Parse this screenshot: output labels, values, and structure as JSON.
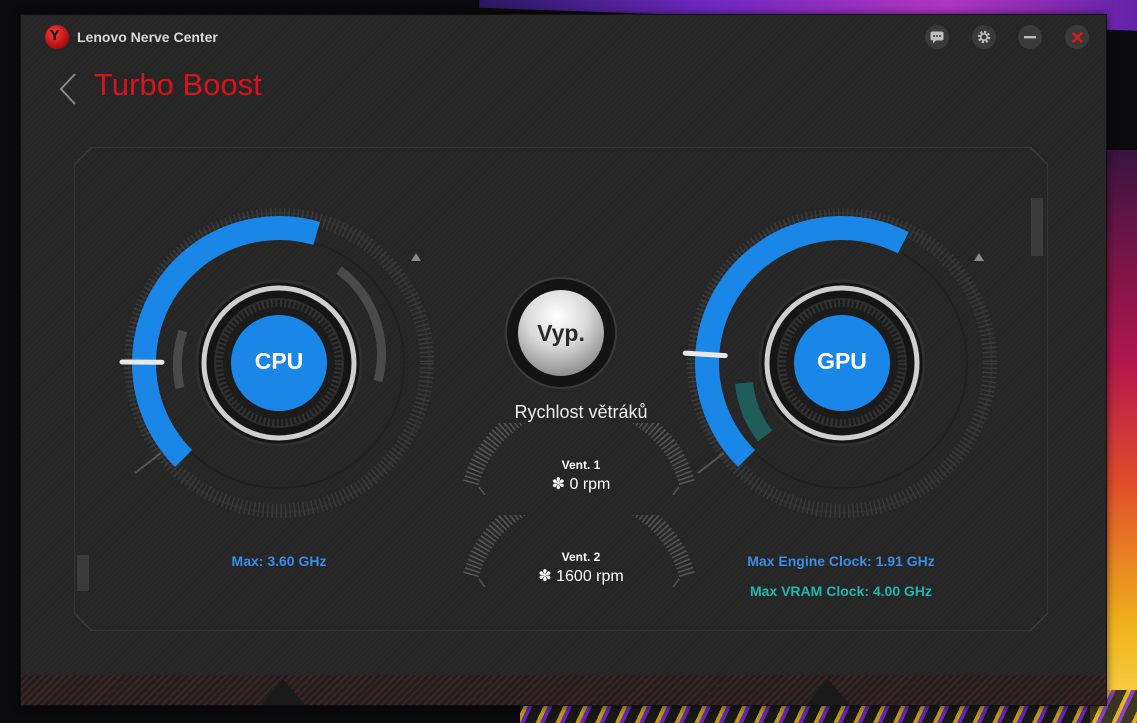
{
  "app": {
    "title": "Lenovo Nerve Center"
  },
  "page": {
    "title": "Turbo Boost"
  },
  "window_controls": [
    {
      "name": "feedback",
      "icon": "chat-icon"
    },
    {
      "name": "settings",
      "icon": "gear-icon"
    },
    {
      "name": "minimize",
      "icon": "minimize-icon"
    },
    {
      "name": "close",
      "icon": "close-icon"
    }
  ],
  "cpu": {
    "label": "CPU",
    "max_text": "Max: 3.60 GHz",
    "boost_level": 0.56
  },
  "gpu": {
    "label": "GPU",
    "engine_text": "Max Engine Clock: 1.91 GHz",
    "vram_text": "Max VRAM Clock: 4.00 GHz",
    "boost_level": 0.6
  },
  "fan": {
    "button_label": "Vyp.",
    "title": "Rychlost větráků",
    "vents": [
      {
        "name": "Vent. 1",
        "rpm": "0 rpm",
        "icon": "fan-icon"
      },
      {
        "name": "Vent. 2",
        "rpm": "1600 rpm",
        "icon": "fan-icon"
      }
    ]
  },
  "colors": {
    "accent_red": "#d9121c",
    "arc_blue": "#1a86e8",
    "cpu_text_blue": "#3b8fe6",
    "vram_teal": "#1fb8b0",
    "window_bg": "#262627"
  }
}
